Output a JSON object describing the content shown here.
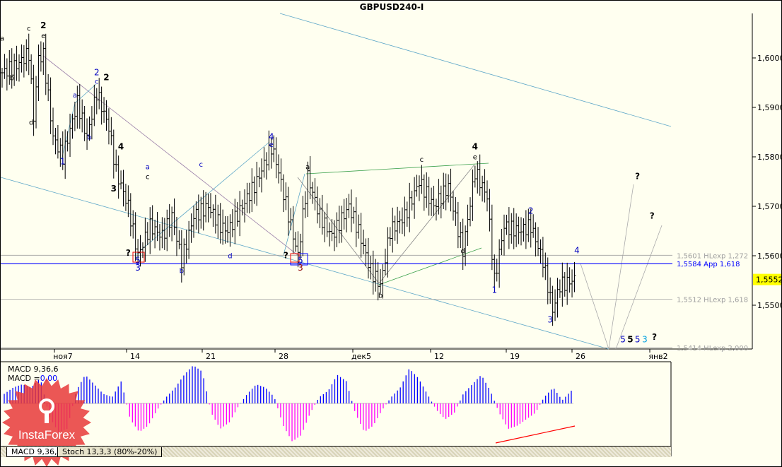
{
  "title": "GBPUSD240-I",
  "chart_data": {
    "type": "candlestick",
    "symbol": "GBPUSD240-I",
    "ylim": [
      1.5405,
      1.6115
    ],
    "y_ticks": [
      "1,6000",
      "1,5900",
      "1,5800",
      "1,5700",
      "1,5600",
      "1,5500"
    ],
    "y_tick_values": [
      1.6,
      1.59,
      1.58,
      1.57,
      1.56,
      1.55
    ],
    "x_ticks": [
      "ноя7",
      "14",
      "21",
      "28",
      "дек5",
      "12",
      "19",
      "26",
      "янв2"
    ],
    "current_price": "1,5552",
    "price_path": {
      "bar": [
        0,
        6,
        11,
        13,
        15,
        17,
        21,
        25,
        31,
        35,
        39,
        44,
        47,
        52,
        56,
        61,
        66,
        70,
        74,
        79,
        85,
        90,
        93,
        99,
        105,
        111,
        113,
        120,
        122,
        126,
        131,
        136,
        143,
        147,
        152,
        156,
        160,
        166,
        172,
        178,
        184,
        190,
        195,
        200,
        203,
        207,
        213,
        218,
        223,
        227,
        230,
        236
      ],
      "price": [
        1.597,
        1.5985,
        1.601,
        1.588,
        1.6,
        1.6005,
        1.584,
        1.58,
        1.591,
        1.584,
        1.593,
        1.586,
        1.577,
        1.57,
        1.56,
        1.566,
        1.564,
        1.568,
        1.559,
        1.568,
        1.57,
        1.566,
        1.565,
        1.57,
        1.575,
        1.582,
        1.579,
        1.564,
        1.56,
        1.576,
        1.568,
        1.564,
        1.57,
        1.565,
        1.557,
        1.554,
        1.565,
        1.568,
        1.575,
        1.57,
        1.574,
        1.561,
        1.577,
        1.572,
        1.555,
        1.566,
        1.565,
        1.566,
        1.559,
        1.549,
        1.554,
        1.5552
      ]
    },
    "levels": [
      {
        "price": 1.5601,
        "label": "1,5601 HLexp 1,272",
        "color": "#a0a0a0"
      },
      {
        "price": 1.5584,
        "label": "1,5584 App 1,618",
        "color": "#0000ff"
      },
      {
        "price": 1.5512,
        "label": "1,5512 HLexp 1,618",
        "color": "#a0a0a0"
      },
      {
        "price": 1.5414,
        "label": "1,5414 HLexp 2,000",
        "color": "#a0a0a0"
      }
    ],
    "wave_labels": [
      {
        "t": "a",
        "bar": 0,
        "p": 1.6035,
        "c": "#000"
      },
      {
        "t": "c",
        "bar": 11,
        "p": 1.6055,
        "c": "#000"
      },
      {
        "t": "2",
        "bar": 17,
        "p": 1.606,
        "c": "#000"
      },
      {
        "t": "e",
        "bar": 17,
        "p": 1.604,
        "c": "#000"
      },
      {
        "t": "b",
        "bar": 4,
        "p": 1.5955,
        "c": "#000"
      },
      {
        "t": "d",
        "bar": 12,
        "p": 1.5865,
        "c": "#000"
      },
      {
        "t": "a",
        "bar": 30,
        "p": 1.592,
        "c": "#0000c0"
      },
      {
        "t": "1",
        "bar": 25,
        "p": 1.5785,
        "c": "#0000c0"
      },
      {
        "t": "2",
        "bar": 39,
        "p": 1.5965,
        "c": "#0000c0"
      },
      {
        "t": "c",
        "bar": 39,
        "p": 1.5948,
        "c": "#0000c0"
      },
      {
        "t": "2",
        "bar": 43,
        "p": 1.5955,
        "c": "#000"
      },
      {
        "t": "b",
        "bar": 36,
        "p": 1.5835,
        "c": "#0000c0"
      },
      {
        "t": "4",
        "bar": 49,
        "p": 1.5815,
        "c": "#000"
      },
      {
        "t": "3",
        "bar": 46,
        "p": 1.573,
        "c": "#000"
      },
      {
        "t": "a",
        "bar": 60,
        "p": 1.5775,
        "c": "#0000c0"
      },
      {
        "t": "c",
        "bar": 60,
        "p": 1.5755,
        "c": "#000"
      },
      {
        "t": "?",
        "bar": 52,
        "p": 1.56,
        "c": "#000"
      },
      {
        "t": "5",
        "bar": 56,
        "p": 1.5585,
        "c": "#0000c0"
      },
      {
        "t": "3",
        "bar": 56,
        "p": 1.557,
        "c": "#0000c0"
      },
      {
        "t": "b",
        "bar": 74,
        "p": 1.5565,
        "c": "#0000c0"
      },
      {
        "t": "c",
        "bar": 82,
        "p": 1.578,
        "c": "#0000c0"
      },
      {
        "t": "d",
        "bar": 94,
        "p": 1.5595,
        "c": "#0000c0"
      },
      {
        "t": "4",
        "bar": 111,
        "p": 1.5835,
        "c": "#0000c0"
      },
      {
        "t": "e",
        "bar": 111,
        "p": 1.582,
        "c": "#0000c0"
      },
      {
        "t": "?",
        "bar": 117,
        "p": 1.5595,
        "c": "#000"
      },
      {
        "t": "5",
        "bar": 123,
        "p": 1.5585,
        "c": "#0000c0"
      },
      {
        "t": "3",
        "bar": 123,
        "p": 1.557,
        "c": "#8b0000"
      },
      {
        "t": "a",
        "bar": 126,
        "p": 1.5775,
        "c": "#000"
      },
      {
        "t": "b",
        "bar": 156,
        "p": 1.5515,
        "c": "#000"
      },
      {
        "t": "c",
        "bar": 173,
        "p": 1.579,
        "c": "#000"
      },
      {
        "t": "d",
        "bar": 190,
        "p": 1.5605,
        "c": "#000"
      },
      {
        "t": "4",
        "bar": 195,
        "p": 1.5815,
        "c": "#000"
      },
      {
        "t": "e",
        "bar": 195,
        "p": 1.5795,
        "c": "#000"
      },
      {
        "t": "1",
        "bar": 203,
        "p": 1.5525,
        "c": "#0000c0"
      },
      {
        "t": "2",
        "bar": 218,
        "p": 1.5685,
        "c": "#0000c0"
      },
      {
        "t": "3",
        "bar": 226,
        "p": 1.5465,
        "c": "#0000c0"
      },
      {
        "t": "4",
        "bar": 237,
        "p": 1.5605,
        "c": "#0000c0"
      },
      {
        "t": "?",
        "bar": 262,
        "p": 1.5755,
        "c": "#000"
      },
      {
        "t": "?",
        "bar": 268,
        "p": 1.5675,
        "c": "#000"
      },
      {
        "t": "5",
        "bar": 256,
        "p": 1.5425,
        "c": "#0000c0"
      },
      {
        "t": "5",
        "bar": 259,
        "p": 1.5425,
        "c": "#000"
      },
      {
        "t": "5",
        "bar": 262,
        "p": 1.5425,
        "c": "#0000c0"
      },
      {
        "t": "3",
        "bar": 265,
        "p": 1.5425,
        "c": "#00a0e0"
      },
      {
        "t": "?",
        "bar": 269,
        "p": 1.543,
        "c": "#000"
      }
    ]
  },
  "macd": {
    "label": "MACD 9,36,6",
    "value_label": "MACD =",
    "value": "0,00",
    "hist_path": [
      3,
      5,
      6,
      5,
      8,
      -4,
      -9,
      -8,
      4,
      9,
      6,
      3,
      2,
      7,
      -5,
      -9,
      -7,
      -2,
      2,
      5,
      9,
      12,
      10,
      -3,
      -8,
      -6,
      -1,
      3,
      6,
      5,
      2,
      -7,
      -12,
      -10,
      -3,
      2,
      4,
      9,
      7,
      -3,
      -9,
      -7,
      -2,
      2,
      5,
      11,
      8,
      3,
      -2,
      -5,
      -3,
      3,
      6,
      9,
      4,
      -3,
      -8,
      -7,
      -5,
      -3,
      2,
      5,
      1,
      4
    ],
    "pos_color": "#0000ff",
    "neg_color": "#ff00ff"
  },
  "tabs": [
    "MACD 9,36,6",
    "Stoch 13,3,3 (80%-20%)"
  ],
  "logo": "InstaForex"
}
